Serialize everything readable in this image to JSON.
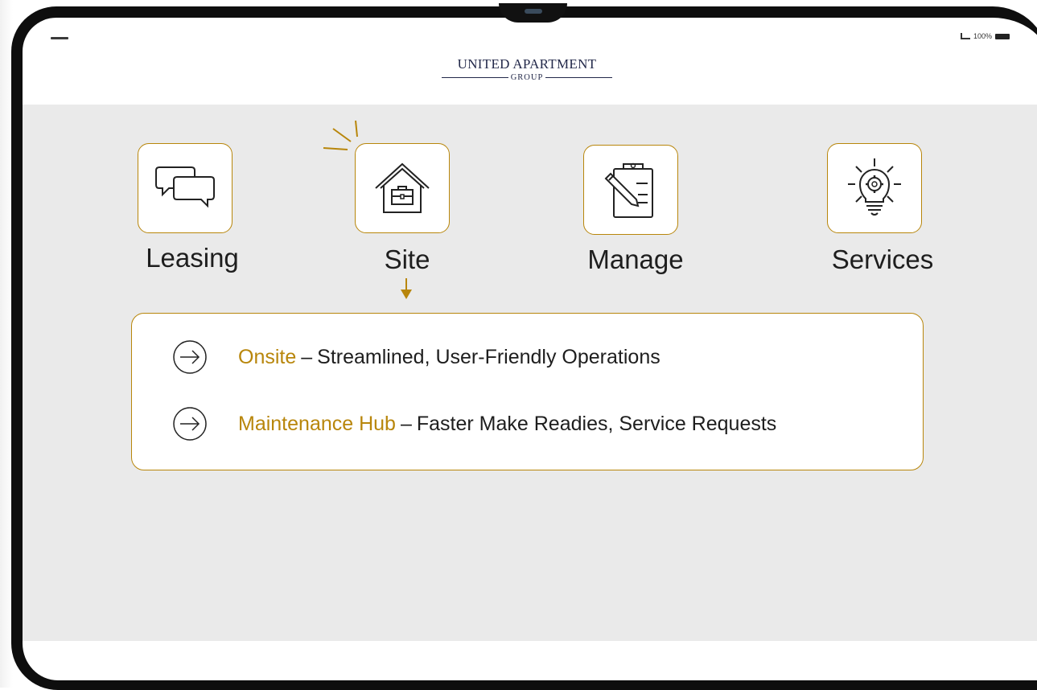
{
  "brand": {
    "logo_line1": "UNITED APARTMENT",
    "logo_line2": "GROUP"
  },
  "status_bar": {
    "battery": "100%"
  },
  "nav": {
    "items": [
      {
        "label": "Leasing",
        "icon": "chat-bubbles-icon"
      },
      {
        "label": "Site",
        "icon": "house-briefcase-icon",
        "selected": true
      },
      {
        "label": "Manage",
        "icon": "clipboard-pencil-icon"
      },
      {
        "label": "Services",
        "icon": "lightbulb-gear-icon"
      }
    ]
  },
  "site_panel": {
    "items": [
      {
        "title": "Onsite",
        "separator": "–",
        "description": "Streamlined, User-Friendly Operations",
        "icon": "arrow-circle-icon"
      },
      {
        "title": "Maintenance Hub",
        "separator": "–",
        "description": "Faster Make Readies, Service Requests",
        "icon": "arrow-circle-icon"
      }
    ]
  },
  "colors": {
    "accent": "#b8860b",
    "panel_bg": "#eaeaea",
    "text": "#1e1e1e",
    "logo_navy": "#23294a"
  }
}
